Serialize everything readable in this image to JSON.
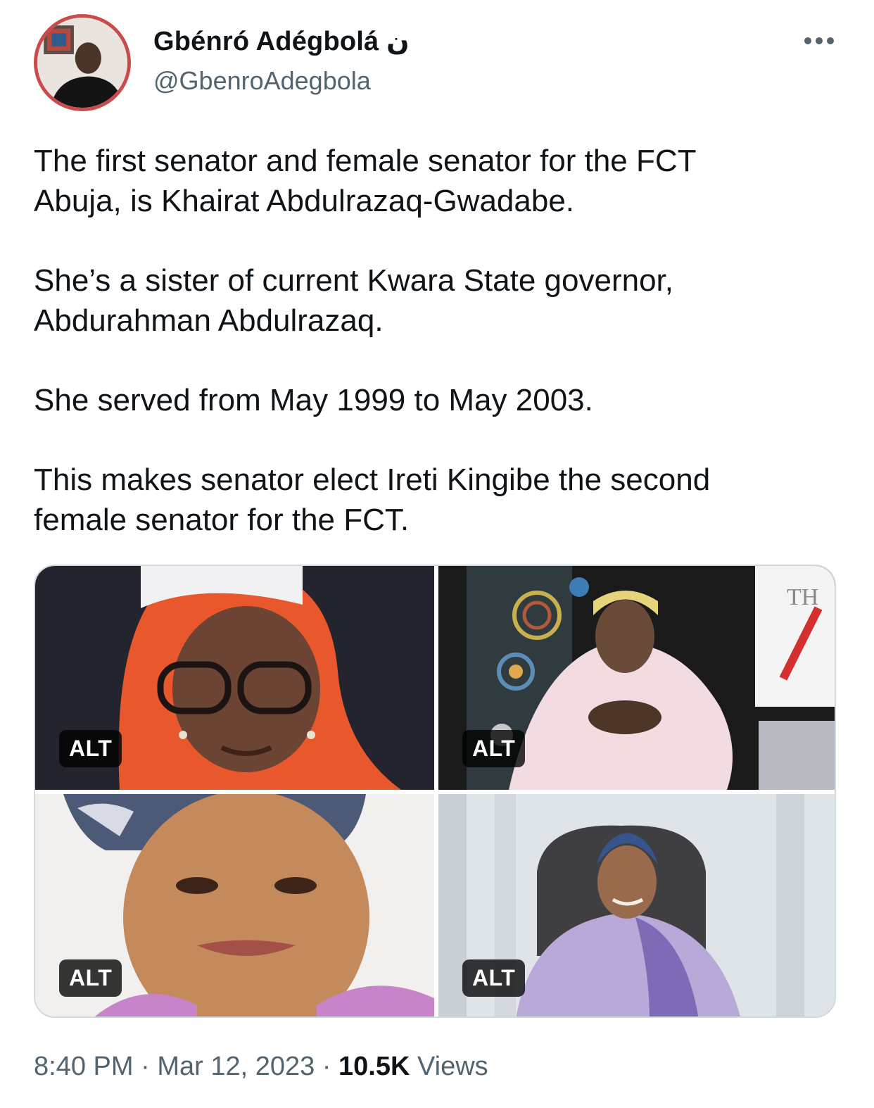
{
  "author": {
    "display_name": "Gbénró Adégbolá ن",
    "handle": "@GbenroAdegbola"
  },
  "tweet": {
    "paragraphs": [
      "The first senator and female senator for the FCT\nAbuja, is Khairat Abdulrazaq-Gwadabe.",
      "She’s a sister of current Kwara State governor,\nAbdurahman Abdulrazaq.",
      "She served from May 1999 to May 2003.",
      "This makes senator elect Ireti Kingibe the second\nfemale senator for the FCT."
    ]
  },
  "media": {
    "badges": [
      "ALT",
      "ALT",
      "ALT",
      "ALT"
    ],
    "image2_sign_text": "TH"
  },
  "meta": {
    "time": "8:40 PM",
    "separator": "·",
    "date": "Mar 12, 2023",
    "views_count": "10.5K",
    "views_label": "Views"
  },
  "icons": {
    "more": "more-horizontal-icon"
  },
  "colors": {
    "text": "#0f1419",
    "secondary": "#536471",
    "avatar_ring": "#c94b4b",
    "border": "#cfd9de"
  }
}
